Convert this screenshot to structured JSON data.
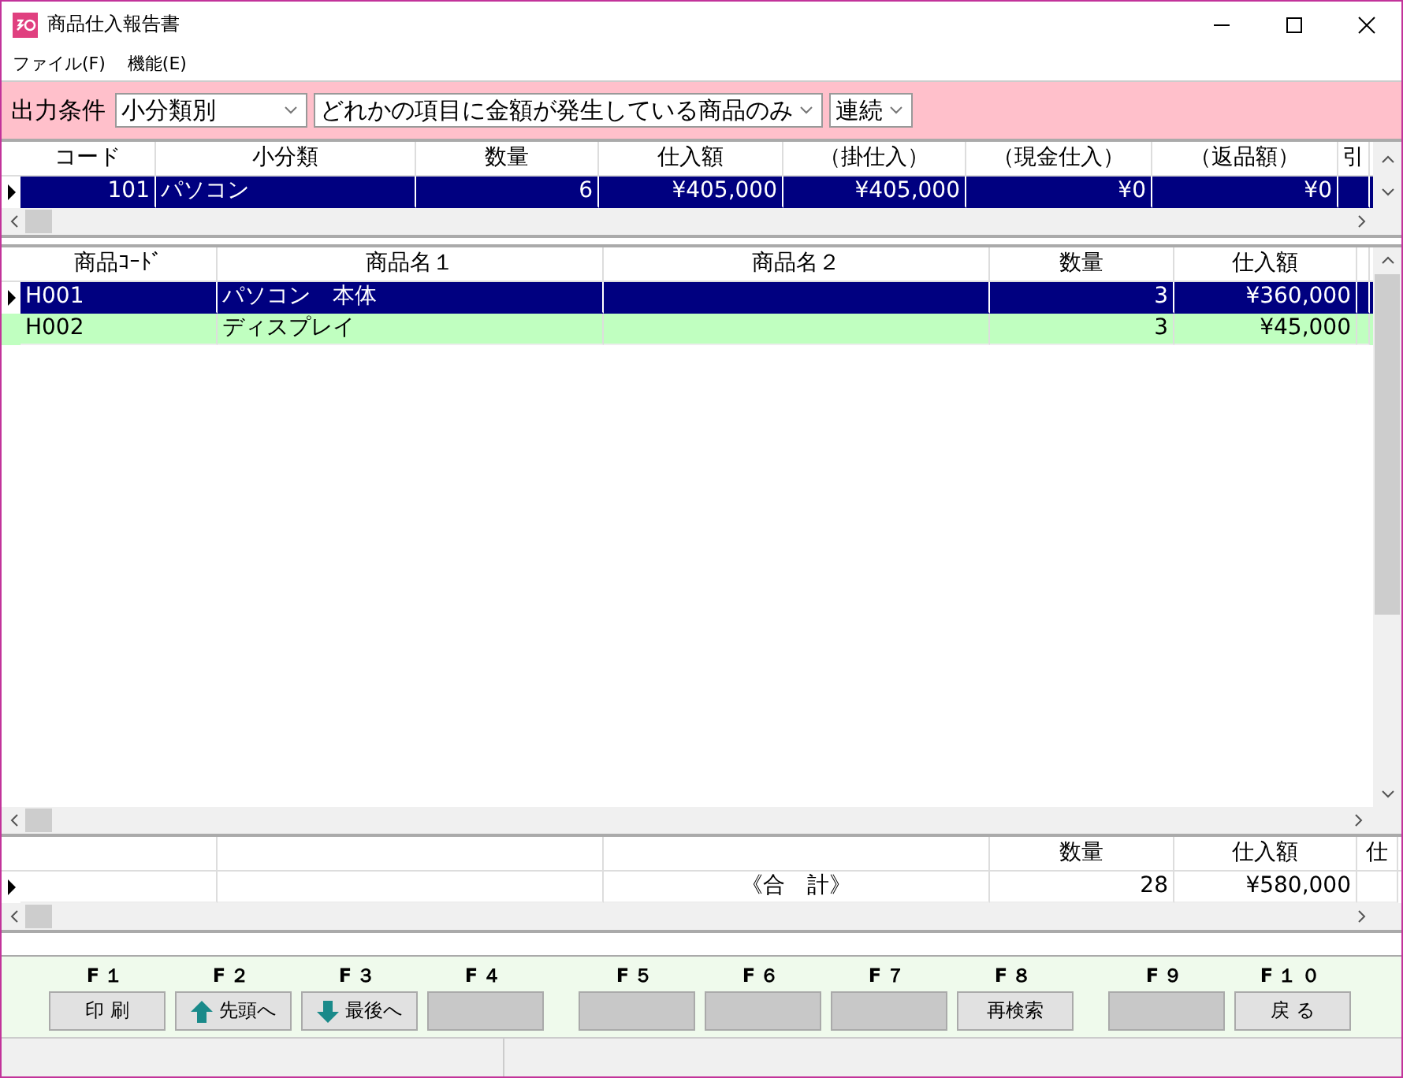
{
  "window": {
    "title": "商品仕入報告書"
  },
  "menu": [
    {
      "label": "ファイル(F)"
    },
    {
      "label": "機能(E)"
    }
  ],
  "filter": {
    "label": "出力条件",
    "dropdowns": [
      {
        "value": "小分類別"
      },
      {
        "value": "どれかの項目に金額が発生している商品のみ"
      },
      {
        "value": "連続"
      }
    ]
  },
  "grids": [
    {
      "columns": [
        {
          "label": "コード",
          "kind": "number"
        },
        {
          "label": "小分類",
          "kind": "text"
        },
        {
          "label": "数量",
          "kind": "number"
        },
        {
          "label": "仕入額",
          "kind": "number"
        },
        {
          "label": "（掛仕入）",
          "kind": "number"
        },
        {
          "label": "（現金仕入）",
          "kind": "number"
        },
        {
          "label": "（返品額）",
          "kind": "number"
        },
        {
          "label": "引",
          "kind": "text"
        }
      ],
      "rows": [
        {
          "current": true,
          "selected": true,
          "code": "101",
          "subcategory": "パソコン",
          "quantity": "6",
          "amount": "¥405,000",
          "credit": "¥405,000",
          "cash": "¥0",
          "returns": "¥0"
        }
      ]
    },
    {
      "columns": [
        {
          "label": "商品ｺｰﾄﾞ",
          "kind": "text"
        },
        {
          "label": "商品名１",
          "kind": "text"
        },
        {
          "label": "商品名２",
          "kind": "text"
        },
        {
          "label": "数量",
          "kind": "number"
        },
        {
          "label": "仕入額",
          "kind": "number"
        },
        {
          "kind": "text"
        }
      ],
      "rows": [
        {
          "current": true,
          "selected": true,
          "code": "H001",
          "name_1": "パソコン　本体",
          "quantity": "3",
          "amount": "¥360,000"
        },
        {
          "current": false,
          "selected": false,
          "highlighted": true,
          "code": "H002",
          "name_1": "ディスプレイ",
          "quantity": "3",
          "amount": "¥45,000"
        }
      ]
    },
    {
      "columns": [
        {
          "kind": "text"
        },
        {
          "kind": "text"
        },
        {
          "kind": "center"
        },
        {
          "label": "数量",
          "kind": "number"
        },
        {
          "label": "仕入額",
          "kind": "number"
        },
        {
          "label": "仕",
          "kind": "text"
        }
      ],
      "rows": [
        {
          "current": true,
          "selected": false,
          "highlighted": false,
          "column_3": "《合　計》",
          "quantity": "28",
          "amount": "¥580,000"
        }
      ]
    }
  ],
  "function_key_groups": [
    {
      "keys": [
        {
          "key": "F１",
          "label": "印 刷",
          "kind": "plain",
          "disabled": false
        },
        {
          "key": "F２",
          "label": "先頭へ",
          "kind": "up",
          "disabled": false
        },
        {
          "key": "F３",
          "label": "最後へ",
          "kind": "down",
          "disabled": false
        },
        {
          "key": "F４",
          "kind": "plain",
          "disabled": true
        }
      ]
    },
    {
      "keys": [
        {
          "key": "F５",
          "kind": "plain",
          "disabled": true
        },
        {
          "key": "F６",
          "kind": "plain",
          "disabled": true
        },
        {
          "key": "F７",
          "kind": "plain",
          "disabled": true
        },
        {
          "key": "F８",
          "label": "再検索",
          "kind": "plain",
          "disabled": false
        }
      ]
    },
    {
      "keys": [
        {
          "key": "F９",
          "kind": "plain",
          "disabled": true
        },
        {
          "key": "F１０",
          "label": "戻 る",
          "kind": "plain",
          "disabled": false
        }
      ]
    }
  ]
}
